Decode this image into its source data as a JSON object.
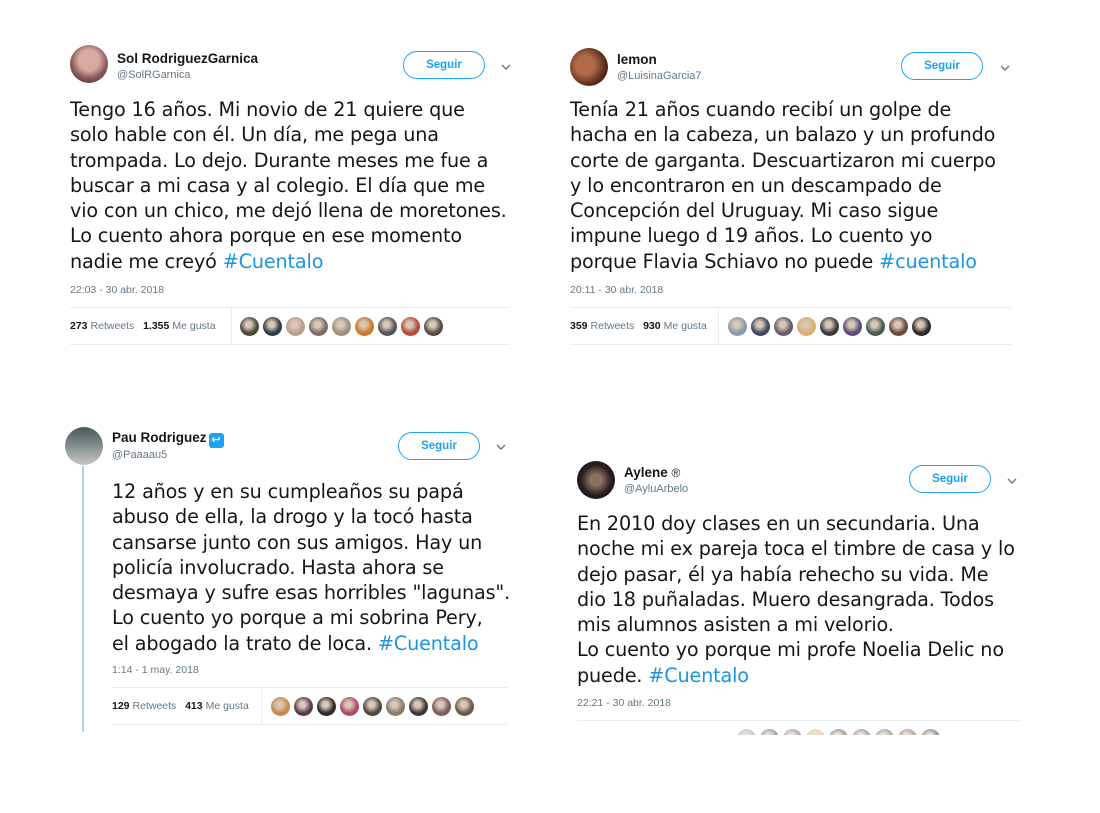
{
  "tweets": [
    {
      "name": "Sol RodriguezGarnica",
      "handle": "@SolRGarnica",
      "follow_label": "Seguir",
      "text_lines": [
        "Tengo 16 años. Mi novio de 21 quiere que",
        "solo hable con él. Un día, me pega una",
        "trompada. Lo dejo. Durante meses me fue a",
        "buscar a mi casa y al colegio. El día que me",
        "vio con un chico, me dejó llena de moretones.",
        "Lo cuento ahora porque en ese momento",
        "nadie me creyó"
      ],
      "hashtag": "#Cuentalo",
      "timestamp": "22:03 - 30 abr. 2018",
      "retweets": "273",
      "retweets_label": "Retweets",
      "likes": "1.355",
      "likes_label": "Me gusta",
      "liker_colors": [
        "#4a4a3a",
        "#2f3b45",
        "#b9a08a",
        "#7a6e6a",
        "#9a8f80",
        "#c77a2e",
        "#555555",
        "#b94a3a",
        "#5a4a40"
      ]
    },
    {
      "name": "lemon",
      "handle": "@LuisinaGarcia7",
      "follow_label": "Seguir",
      "text_lines": [
        "Tenía 21 años cuando recibí un golpe de",
        "hacha en la cabeza, un balazo y un profundo",
        "corte de garganta. Descuartizaron mi cuerpo",
        "y lo encontraron en un descampado de",
        "Concepción del Uruguay. Mi caso sigue",
        "impune luego d 19 años. Lo cuento yo",
        "porque Flavia Schiavo no puede"
      ],
      "hashtag": "#cuentalo",
      "timestamp": "20:11 - 30 abr. 2018",
      "retweets": "359",
      "retweets_label": "Retweets",
      "likes": "930",
      "likes_label": "Me gusta",
      "liker_colors": [
        "#8a9aa8",
        "#3a4a5a",
        "#6a5a6a",
        "#d9b070",
        "#3a3a3a",
        "#5a4a7a",
        "#4a5a4a",
        "#6a4a3a",
        "#2a2a2a"
      ]
    },
    {
      "name": "Pau Rodriguez",
      "handle": "@Paaaau5",
      "follow_label": "Seguir",
      "text_lines": [
        "12 años y en su cumpleaños su papá",
        "abuso de ella, la drogo y la tocó hasta",
        "cansarse junto con sus amigos. Hay un",
        "policía involucrado. Hasta ahora se",
        "desmaya y sufre esas horribles \"lagunas\".",
        "Lo cuento yo porque a mi sobrina Pery,",
        "el abogado la trato de loca."
      ],
      "hashtag": "#Cuentalo",
      "timestamp": "1:14 - 1 may. 2018",
      "retweets": "129",
      "retweets_label": "Retweets",
      "likes": "413",
      "likes_label": "Me gusta",
      "liker_colors": [
        "#c98a4a",
        "#5a3a4a",
        "#2a2a2a",
        "#b04a6a",
        "#4a4a3a",
        "#8a7a6a",
        "#3a3a3a",
        "#7a5a5a",
        "#6a5a4a"
      ]
    },
    {
      "name": "Aylene",
      "name_suffix": "®",
      "handle": "@AyluArbelo",
      "follow_label": "Seguir",
      "text_lines": [
        "En 2010 doy clases en un secundaria. Una",
        "noche mi ex pareja toca el timbre de casa y lo",
        "dejo pasar, él ya había rehecho su vida. Me",
        "dio 18 puñaladas. Muero desangrada. Todos",
        "mis alumnos asisten a mi velorio.",
        "Lo cuento yo porque mi profe Noelia Delic no",
        "puede."
      ],
      "hashtag": "#Cuentalo",
      "timestamp": "22:21 - 30 abr. 2018"
    }
  ],
  "colors": {
    "accent": "#1da1f2",
    "hashtag": "#1b95e0",
    "muted": "#657786",
    "divider": "#e6ecf0"
  }
}
